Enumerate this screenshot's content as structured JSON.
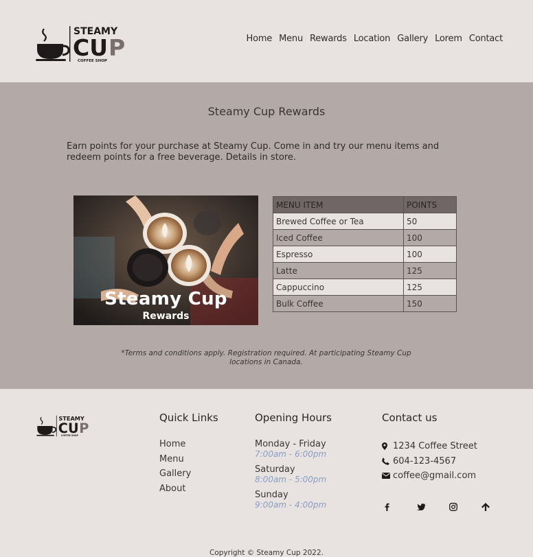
{
  "brand": {
    "line1": "STEAMY",
    "line2a": "CU",
    "line2b": "P",
    "line3": "COFFEE SHOP"
  },
  "nav": [
    "Home",
    "Menu",
    "Rewards",
    "Location",
    "Gallery",
    "Lorem",
    "Contact"
  ],
  "main": {
    "title": "Steamy Cup Rewards",
    "intro": "Earn points for your purchase at Steamy Cup. Come in and try our menu items and redeem points for a free beverage. Details in store.",
    "photo_title": "Steamy Cup",
    "photo_sub": "Rewards",
    "table": {
      "headers": [
        "MENU ITEM",
        "POINTS"
      ],
      "rows": [
        [
          "Brewed Coffee or Tea",
          "50"
        ],
        [
          "Iced Coffee",
          "100"
        ],
        [
          "Espresso",
          "100"
        ],
        [
          "Latte",
          "125"
        ],
        [
          "Cappuccino",
          "125"
        ],
        [
          "Bulk Coffee",
          "150"
        ]
      ]
    },
    "terms": "*Terms and conditions apply. Registration required. At participating Steamy Cup locations in Canada."
  },
  "footer": {
    "quick_links_title": "Quick Links",
    "quick_links": [
      "Home",
      "Menu",
      "Gallery",
      "About"
    ],
    "hours_title": "Opening Hours",
    "hours": [
      {
        "day": "Monday - Friday",
        "time": "7:00am - 6:00pm"
      },
      {
        "day": "Saturday",
        "time": "8:00am - 5:00pm"
      },
      {
        "day": "Sunday",
        "time": "9:00am - 4:00pm"
      }
    ],
    "contact_title": "Contact us",
    "address": "1234 Coffee Street",
    "phone": "604-123-4567",
    "email": "coffee@gmail.com",
    "social_icons": [
      "facebook-icon",
      "twitter-icon",
      "instagram-icon",
      "arrow-up-icon"
    ],
    "copyright": "Copyright © Steamy Cup 2022."
  },
  "colors": {
    "header_bg": "#e8e3e1",
    "main_bg": "#b3aaa7",
    "table_header": "#6f6665",
    "hours_accent": "#8a9ec4"
  }
}
